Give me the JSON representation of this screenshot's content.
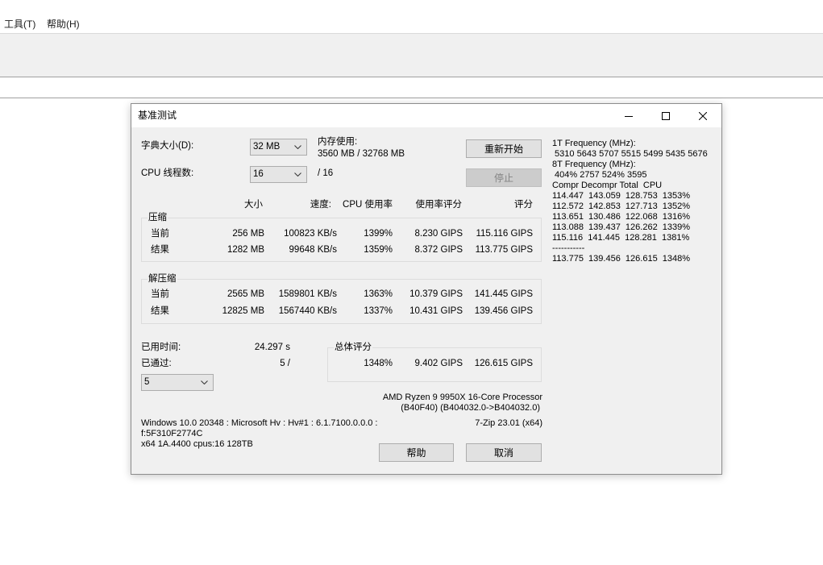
{
  "menubar": {
    "items": [
      {
        "label": "工具(T)"
      },
      {
        "label": "帮助(H)"
      }
    ]
  },
  "dialog": {
    "title": "基准测试",
    "caption_buttons": {
      "minimize": "minimize-icon",
      "maximize": "maximize-icon",
      "close": "close-icon"
    },
    "dictionary": {
      "label": "字典大小(D):",
      "value": "32 MB"
    },
    "memory": {
      "label": "内存使用:",
      "value": "3560 MB / 32768 MB"
    },
    "threads": {
      "label": "CPU 线程数:",
      "value": "16",
      "max": "/ 16"
    },
    "buttons": {
      "restart": "重新开始",
      "stop": "停止",
      "help": "帮助",
      "cancel": "取消"
    },
    "columns": {
      "size": "大小",
      "speed": "速度:",
      "cpu_usage": "CPU 使用率",
      "usage_rating": "使用率评分",
      "rating": "评分"
    },
    "compress": {
      "title": "压缩",
      "rows": [
        {
          "label": "当前",
          "size": "256 MB",
          "speed": "100823 KB/s",
          "cpu_usage": "1399%",
          "usage_rating": "8.230 GIPS",
          "rating": "115.116 GIPS"
        },
        {
          "label": "结果",
          "size": "1282 MB",
          "speed": "99648 KB/s",
          "cpu_usage": "1359%",
          "usage_rating": "8.372 GIPS",
          "rating": "113.775 GIPS"
        }
      ]
    },
    "decompress": {
      "title": "解压缩",
      "rows": [
        {
          "label": "当前",
          "size": "2565 MB",
          "speed": "1589801 KB/s",
          "cpu_usage": "1363%",
          "usage_rating": "10.379 GIPS",
          "rating": "141.445 GIPS"
        },
        {
          "label": "结果",
          "size": "12825 MB",
          "speed": "1567440 KB/s",
          "cpu_usage": "1337%",
          "usage_rating": "10.431 GIPS",
          "rating": "139.456 GIPS"
        }
      ]
    },
    "elapsed": {
      "label": "已用时间:",
      "value": "24.297 s"
    },
    "passed": {
      "label": "已通过:",
      "value": "5 /"
    },
    "passes_select": {
      "value": "5"
    },
    "total": {
      "title": "总体评分",
      "cpu_usage": "1348%",
      "usage_rating": "9.402 GIPS",
      "rating": "126.615 GIPS"
    },
    "cpu": {
      "name": "AMD Ryzen 9 9950X 16-Core Processor",
      "id": "(B40F40) (B404032.0->B404032.0)"
    },
    "system": [
      "Windows 10.0 20348 : Microsoft Hv : Hv#1 : 6.1.7100.0.0.0 :",
      "f:5F310F2774C",
      "x64 1A.4400 cpus:16 128TB"
    ],
    "version": "7-Zip 23.01 (x64)",
    "log": [
      "1T Frequency (MHz):",
      " 5310 5643 5707 5515 5499 5435 5676",
      "8T Frequency (MHz):",
      " 404% 2757 524% 3595",
      "Compr Decompr Total  CPU",
      "114.447  143.059  128.753  1353%",
      "112.572  142.853  127.713  1352%",
      "113.651  130.486  122.068  1316%",
      "113.088  139.437  126.262  1339%",
      "115.116  141.445  128.281  1381%",
      "-----------",
      "113.775  139.456  126.615  1348%"
    ]
  }
}
